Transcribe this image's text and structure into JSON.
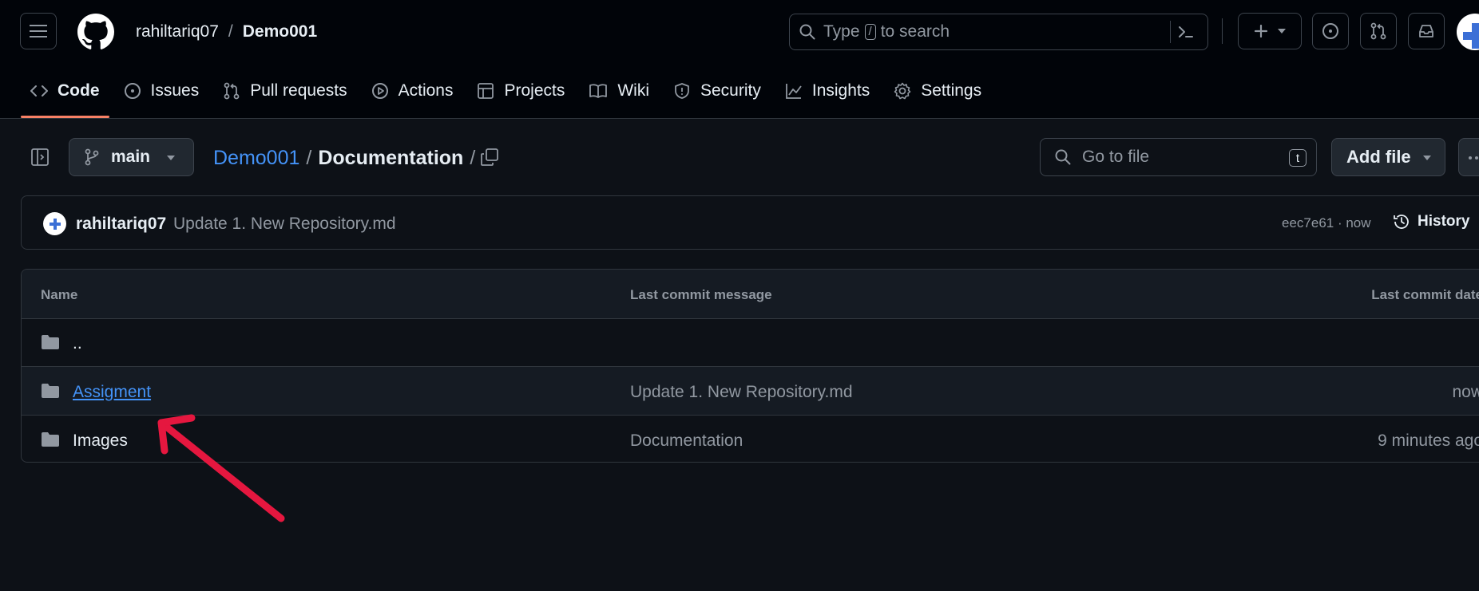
{
  "header": {
    "owner": "rahiltariq07",
    "separator": "/",
    "repo": "Demo001",
    "search_prefix": "Type",
    "search_key": "/",
    "search_suffix": "to search"
  },
  "tabs": [
    {
      "label": "Code",
      "icon": "code-icon"
    },
    {
      "label": "Issues",
      "icon": "issue-icon"
    },
    {
      "label": "Pull requests",
      "icon": "pull-request-icon"
    },
    {
      "label": "Actions",
      "icon": "play-icon"
    },
    {
      "label": "Projects",
      "icon": "table-icon"
    },
    {
      "label": "Wiki",
      "icon": "book-icon"
    },
    {
      "label": "Security",
      "icon": "shield-icon"
    },
    {
      "label": "Insights",
      "icon": "graph-icon"
    },
    {
      "label": "Settings",
      "icon": "gear-icon"
    }
  ],
  "toolbar": {
    "branch": "main",
    "path_root": "Demo001",
    "path_sep": "/",
    "path_current": "Documentation",
    "path_trailing": "/",
    "goto_placeholder": "Go to file",
    "goto_key": "t",
    "add_file_label": "Add file"
  },
  "commit": {
    "author": "rahiltariq07",
    "message": "Update 1. New Repository.md",
    "meta": "eec7e61 · now",
    "history_label": "History"
  },
  "table": {
    "headers": {
      "name": "Name",
      "message": "Last commit message",
      "date": "Last commit date"
    },
    "rows": [
      {
        "name": "..",
        "message": "",
        "date": ""
      },
      {
        "name": "Assigment",
        "message": "Update 1. New Repository.md",
        "date": "now"
      },
      {
        "name": "Images",
        "message": "Documentation",
        "date": "9 minutes ago"
      }
    ]
  },
  "colors": {
    "background": "#0d1117",
    "header_bg": "#010409",
    "link": "#4493f8",
    "active_tab_underline": "#f78166",
    "annotation_arrow": "#e5173f"
  }
}
